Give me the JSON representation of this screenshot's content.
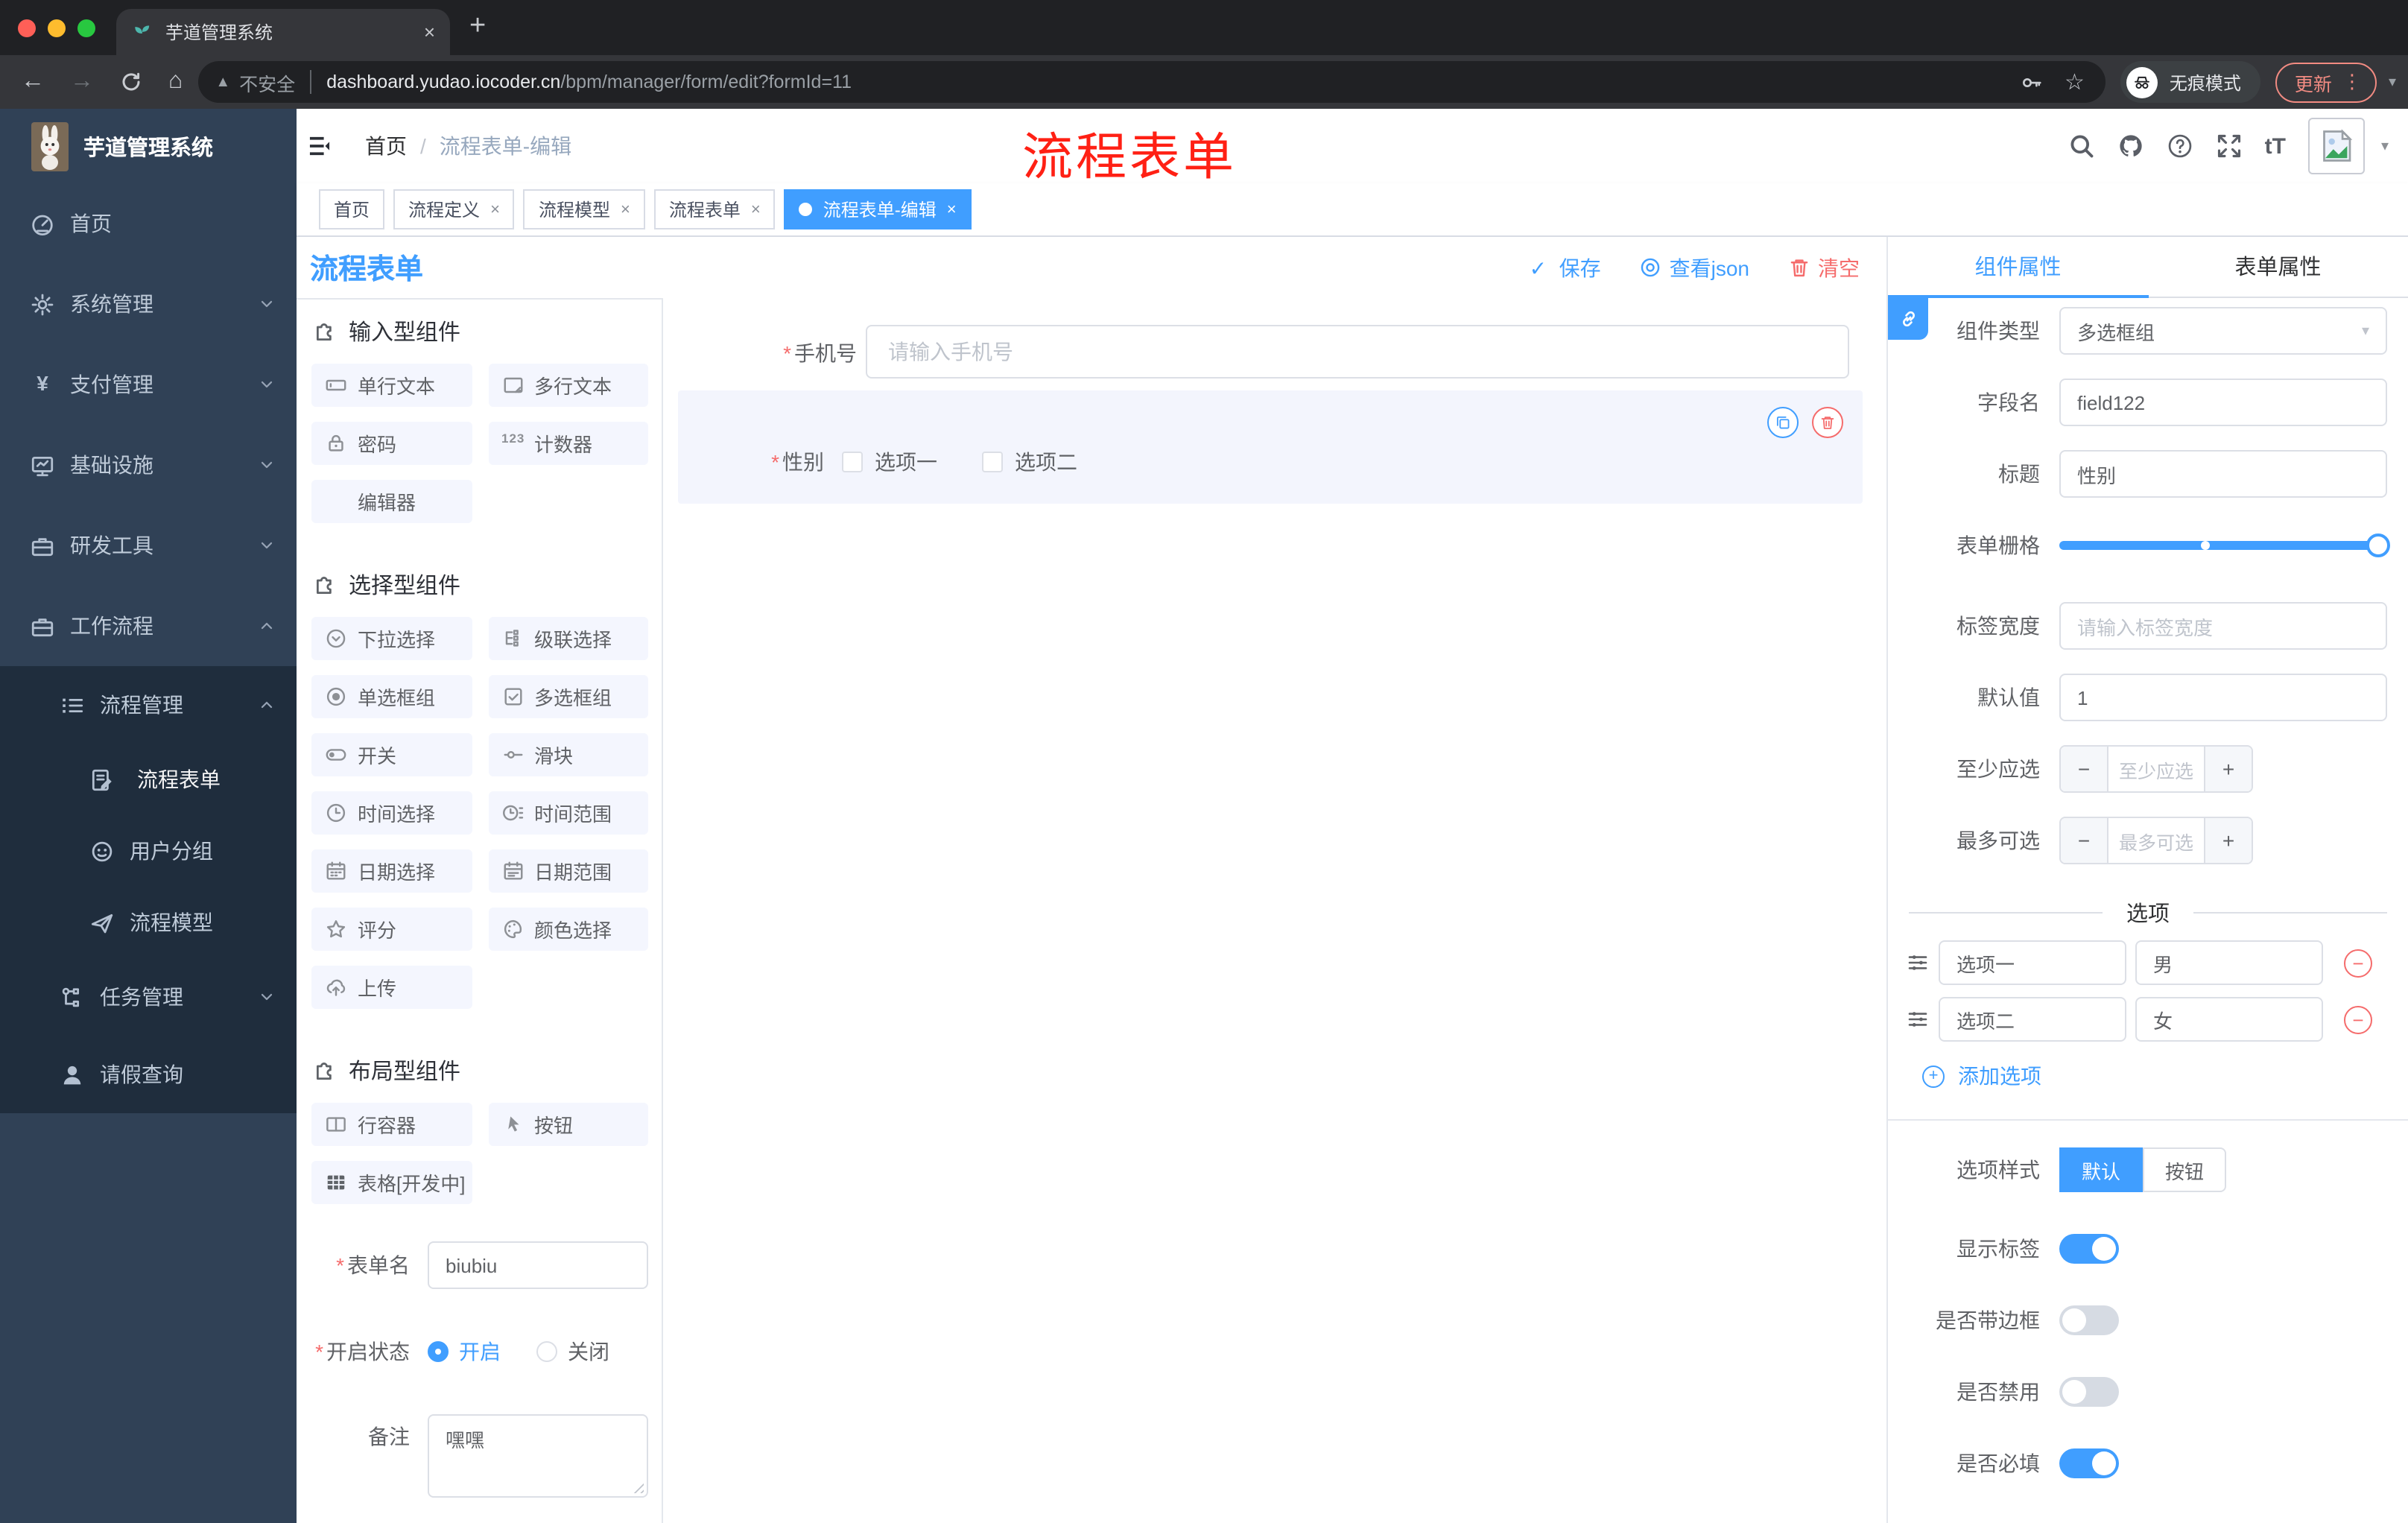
{
  "browser": {
    "tab": {
      "title": "芋道管理系统",
      "favicon": "sprout",
      "close": "×"
    },
    "new_tab": "+",
    "url": {
      "warning_label": "不安全",
      "host": "dashboard.yudao.iocoder.cn",
      "path": "/bpm/manager/form/edit?formId=11"
    },
    "incognito_label": "无痕模式",
    "update_label": "更新",
    "menu_dots": "⋮"
  },
  "sidebar": {
    "title": "芋道管理系统",
    "items": [
      {
        "label": "首页",
        "icon": "dashboard"
      },
      {
        "label": "系统管理",
        "icon": "gear"
      },
      {
        "label": "支付管理",
        "icon": "yen"
      },
      {
        "label": "基础设施",
        "icon": "monitor"
      },
      {
        "label": "研发工具",
        "icon": "briefcase"
      },
      {
        "label": "工作流程",
        "icon": "briefcase",
        "expanded": true
      }
    ],
    "submenu": {
      "group": {
        "label": "流程管理",
        "icon": "listtree",
        "expanded": true
      },
      "children": [
        {
          "label": "流程表单",
          "icon": "docedit",
          "active": true
        },
        {
          "label": "用户分组",
          "icon": "face"
        },
        {
          "label": "流程模型",
          "icon": "plane"
        }
      ],
      "siblings": [
        {
          "label": "任务管理",
          "icon": "tree",
          "expandable": true
        },
        {
          "label": "请假查询",
          "icon": "person"
        }
      ]
    }
  },
  "topbar": {
    "breadcrumb": {
      "home": "首页",
      "separator": "/",
      "current": "流程表单-编辑"
    }
  },
  "annotation": {
    "text": "流程表单",
    "color": "#ff2014"
  },
  "tags": [
    {
      "label": "首页",
      "closable": false,
      "active": false
    },
    {
      "label": "流程定义",
      "closable": true,
      "active": false
    },
    {
      "label": "流程模型",
      "closable": true,
      "active": false
    },
    {
      "label": "流程表单",
      "closable": true,
      "active": false
    },
    {
      "label": "流程表单-编辑",
      "closable": true,
      "active": true
    }
  ],
  "designer": {
    "title": "流程表单",
    "actions": {
      "save": "保存",
      "view_json": "查看json",
      "clear": "清空"
    }
  },
  "palette": {
    "groups": [
      {
        "title": "输入型组件",
        "items": [
          {
            "label": "单行文本",
            "icon": "input"
          },
          {
            "label": "多行文本",
            "icon": "textarea"
          },
          {
            "label": "密码",
            "icon": "password"
          },
          {
            "label": "计数器",
            "icon": "counter"
          },
          {
            "label": "编辑器",
            "icon": ""
          }
        ]
      },
      {
        "title": "选择型组件",
        "items": [
          {
            "label": "下拉选择",
            "icon": "select"
          },
          {
            "label": "级联选择",
            "icon": "cascader"
          },
          {
            "label": "单选框组",
            "icon": "radio"
          },
          {
            "label": "多选框组",
            "icon": "checkbox"
          },
          {
            "label": "开关",
            "icon": "switch"
          },
          {
            "label": "滑块",
            "icon": "slider"
          },
          {
            "label": "时间选择",
            "icon": "time"
          },
          {
            "label": "时间范围",
            "icon": "timerange"
          },
          {
            "label": "日期选择",
            "icon": "date"
          },
          {
            "label": "日期范围",
            "icon": "daterange"
          },
          {
            "label": "评分",
            "icon": "rate"
          },
          {
            "label": "颜色选择",
            "icon": "color"
          },
          {
            "label": "上传",
            "icon": "upload"
          }
        ]
      },
      {
        "title": "布局型组件",
        "items": [
          {
            "label": "行容器",
            "icon": "rowcont"
          },
          {
            "label": "按钮",
            "icon": "pointer"
          },
          {
            "label": "表格[开发中]",
            "icon": "tablegrid"
          }
        ]
      }
    ]
  },
  "form_settings": {
    "name_label": "表单名",
    "name_value": "biubiu",
    "status_label": "开启状态",
    "status_options": [
      {
        "label": "开启",
        "selected": true
      },
      {
        "label": "关闭",
        "selected": false
      }
    ],
    "remark_label": "备注",
    "remark_value": "嘿嘿"
  },
  "canvas": {
    "phone": {
      "label": "手机号",
      "required": true,
      "placeholder": "请输入手机号"
    },
    "gender": {
      "label": "性别",
      "required": true,
      "options": [
        {
          "label": "选项一"
        },
        {
          "label": "选项二"
        }
      ]
    }
  },
  "props": {
    "tabs": {
      "component": "组件属性",
      "form": "表单属性"
    },
    "component_type": {
      "label": "组件类型",
      "value": "多选框组"
    },
    "field_name": {
      "label": "字段名",
      "value": "field122"
    },
    "title": {
      "label": "标题",
      "value": "性别"
    },
    "grid": {
      "label": "表单栅格",
      "value_percent": 100,
      "mark_percent": 46
    },
    "label_width": {
      "label": "标签宽度",
      "placeholder": "请输入标签宽度"
    },
    "default_value": {
      "label": "默认值",
      "value": "1"
    },
    "min_select": {
      "label": "至少应选",
      "placeholder": "至少应选"
    },
    "max_select": {
      "label": "最多可选",
      "placeholder": "最多可选"
    },
    "options_divider": "选项",
    "options": [
      {
        "label": "选项一",
        "value": "男"
      },
      {
        "label": "选项二",
        "value": "女"
      }
    ],
    "add_option": "添加选项",
    "option_style": {
      "label": "选项样式",
      "options": [
        {
          "label": "默认",
          "active": true
        },
        {
          "label": "按钮",
          "active": false
        }
      ]
    },
    "toggles": [
      {
        "label": "显示标签",
        "on": true
      },
      {
        "label": "是否带边框",
        "on": false
      },
      {
        "label": "是否禁用",
        "on": false
      },
      {
        "label": "是否必填",
        "on": true
      }
    ],
    "colors": {
      "accent": "#409EFF",
      "danger": "#F56C6C"
    }
  }
}
